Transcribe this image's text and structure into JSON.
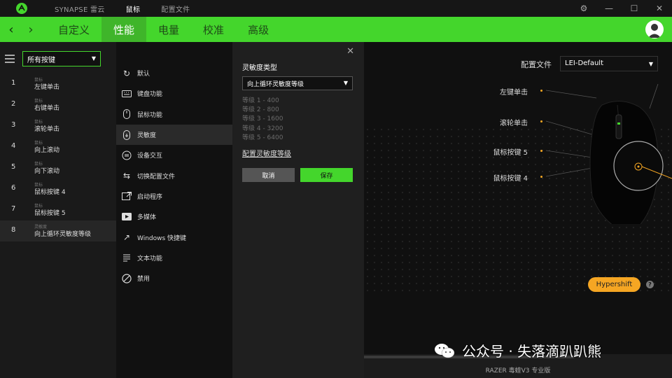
{
  "titlebar": {
    "app": "SYNAPSE 雷云",
    "items": [
      {
        "label": "鼠标",
        "active": true
      },
      {
        "label": "配置文件",
        "active": false
      }
    ]
  },
  "nav": {
    "tabs": [
      {
        "label": "自定义",
        "active": false
      },
      {
        "label": "性能",
        "active": true
      },
      {
        "label": "电量",
        "active": false
      },
      {
        "label": "校准",
        "active": false
      },
      {
        "label": "高级",
        "active": false
      }
    ]
  },
  "left": {
    "filter": "所有按键",
    "buttons": [
      {
        "num": "1",
        "cat": "鼠标",
        "label": "左键单击"
      },
      {
        "num": "2",
        "cat": "鼠标",
        "label": "右键单击"
      },
      {
        "num": "3",
        "cat": "鼠标",
        "label": "滚轮单击"
      },
      {
        "num": "4",
        "cat": "鼠标",
        "label": "向上滚动"
      },
      {
        "num": "5",
        "cat": "鼠标",
        "label": "向下滚动"
      },
      {
        "num": "6",
        "cat": "鼠标",
        "label": "鼠标按键 4"
      },
      {
        "num": "7",
        "cat": "鼠标",
        "label": "鼠标按键 5"
      },
      {
        "num": "8",
        "cat": "灵敏度",
        "label": "向上循环灵敏度等级"
      }
    ]
  },
  "functions": [
    {
      "icon": "reset-icon",
      "label": "默认"
    },
    {
      "icon": "keyboard-icon",
      "label": "键盘功能"
    },
    {
      "icon": "mouse-icon",
      "label": "鼠标功能"
    },
    {
      "icon": "sensitivity-icon",
      "label": "灵敏度"
    },
    {
      "icon": "device-interop-icon",
      "label": "设备交互"
    },
    {
      "icon": "switch-profile-icon",
      "label": "切换配置文件"
    },
    {
      "icon": "launch-program-icon",
      "label": "启动程序"
    },
    {
      "icon": "multimedia-icon",
      "label": "多媒体"
    },
    {
      "icon": "windows-shortcut-icon",
      "label": "Windows 快捷键"
    },
    {
      "icon": "text-function-icon",
      "label": "文本功能"
    },
    {
      "icon": "disable-icon",
      "label": "禁用"
    }
  ],
  "panel": {
    "heading": "灵敏度类型",
    "select": "向上循环灵敏度等级",
    "levels": [
      "等级 1 - 400",
      "等级 2 - 800",
      "等级 3 - 1600",
      "等级 4 - 3200",
      "等级 5 - 6400"
    ],
    "link": "配置灵敏度等级",
    "cancel": "取消",
    "save": "保存"
  },
  "right": {
    "profile_label": "配置文件",
    "profile_value": "LEI-Default",
    "mouse_labels": [
      "左键单击",
      "滚轮单击",
      "鼠标按键 5",
      "鼠标按键 4"
    ],
    "hypershift": "Hypershift",
    "help": "?",
    "device": "RAZER 毒蝰V3 专业版"
  },
  "watermark": "公众号 · 失落滴趴趴熊",
  "colors": {
    "accent": "#44d62c",
    "hypershift": "#f5a623"
  }
}
